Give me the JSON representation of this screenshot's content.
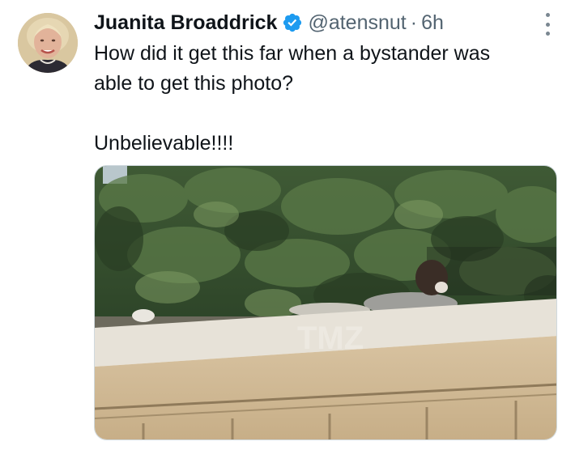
{
  "tweet": {
    "author": {
      "display_name": "Juanita Broaddrick",
      "handle": "@atensnut",
      "verified": true
    },
    "separator": "·",
    "time": "6h",
    "text_lines": [
      "How did it get this far when a bystander was",
      "able to get this photo?",
      "Unbelievable!!!!"
    ],
    "media": {
      "type": "photo",
      "watermark": "TMZ"
    }
  },
  "icons": {
    "verified_badge": "verified-check-icon",
    "more_menu": "more-vertical-icon"
  },
  "colors": {
    "primary_text": "#0f1419",
    "secondary_text": "#536471",
    "verified_blue": "#1d9bf0",
    "background": "#ffffff"
  }
}
